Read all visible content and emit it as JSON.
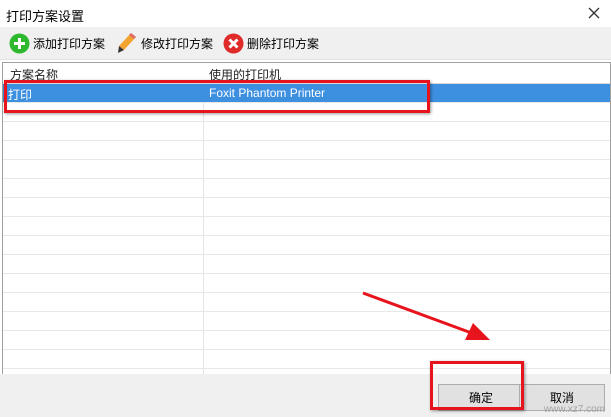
{
  "window": {
    "title": "打印方案设置"
  },
  "toolbar": {
    "add_label": "添加打印方案",
    "edit_label": "修改打印方案",
    "delete_label": "删除打印方案"
  },
  "table": {
    "columns": [
      "方案名称",
      "使用的打印机"
    ],
    "rows": [
      {
        "name": "打印",
        "printer": "Foxit Phantom Printer"
      }
    ]
  },
  "footer": {
    "ok_label": "确定",
    "cancel_label": "取消"
  },
  "watermark": "www.xz7.com",
  "colors": {
    "selection": "#3d8fe0",
    "annotation": "#e8141d",
    "add_icon": "#2eb82e",
    "delete_icon": "#e02b2b",
    "edit_icon": "#f3a32f"
  }
}
